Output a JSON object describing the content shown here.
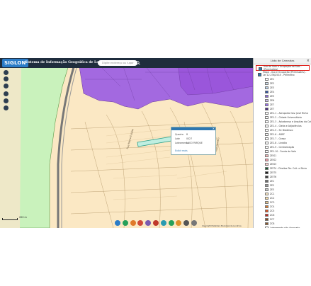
{
  "header": {
    "logo": "SIGLON",
    "title": "Sistema de Informação Geográfica de Londrina",
    "search_placeholder": "Digite endereço ou lugar"
  },
  "legend": {
    "title": "Lista de Camadas",
    "active_layer": "Uso do Solo e Ocupação do Solo - (Permissões)",
    "sub_layer": "Mapa - Uso e Ocupação (Permissões) - Lei 12.236/2015 - Perímetro",
    "items": [
      {
        "label": "ZE1",
        "color": "#ffffff"
      },
      {
        "label": "ZE2",
        "color": "#cfe0f0"
      },
      {
        "label": "ZE3",
        "color": "#b8d0e8"
      },
      {
        "label": "ZE4",
        "color": "#2c4fa0"
      },
      {
        "label": "ZE5",
        "color": "#8e6ad8"
      },
      {
        "label": "ZE6",
        "color": "#c9b8ea"
      },
      {
        "label": "ZE7",
        "color": "#9a6ef0"
      },
      {
        "label": "ZE7",
        "color": "#4b2a80"
      },
      {
        "label": "ZE1.1 - Aeroporto Gov. José Richa",
        "color": "#ffffff"
      },
      {
        "label": "ZE1.2 - Cidade Universitária",
        "color": "#ffffff"
      },
      {
        "label": "ZE1.3 - Aviadoroso e Arquitas do Café",
        "color": "#ffffff"
      },
      {
        "label": "ZE1.4 - Gleba e Adjacências",
        "color": "#ffffff"
      },
      {
        "label": "ZE1.5 - SC Bradesco",
        "color": "#ffffff"
      },
      {
        "label": "ZE1.6 - ADEF",
        "color": "#ffffff"
      },
      {
        "label": "ZE1.7 - Ceasa",
        "color": "#ffffff"
      },
      {
        "label": "ZE1.8 - Lindóia",
        "color": "#ffffff"
      },
      {
        "label": "ZE1.9 - Centralização",
        "color": "#ffffff"
      },
      {
        "label": "ZE1.10 - Fundo de Vale",
        "color": "#ffffff"
      },
      {
        "label": "ZEIS1",
        "color": "#f3b8b8"
      },
      {
        "label": "ZEIS2",
        "color": "#f59aa8"
      },
      {
        "label": "ZEIS3",
        "color": "#fbd0d0"
      },
      {
        "label": "ZEIT4 - Direitos Ter. Cult. e Sócio",
        "color": "#175a30"
      },
      {
        "label": "ZEIT5",
        "color": "#1a1a1a"
      },
      {
        "label": "ZEIT6",
        "color": "#3a3a3a"
      },
      {
        "label": "ZE1",
        "color": "#6b6b6b"
      },
      {
        "label": "ZE2",
        "color": "#9a9a9a"
      },
      {
        "label": "ZE3",
        "color": "#c8c8c8"
      },
      {
        "label": "ZC1",
        "color": "#fbe8c4"
      },
      {
        "label": "ZC2",
        "color": "#f2d9a8"
      },
      {
        "label": "ZC3",
        "color": "#e8c48a"
      },
      {
        "label": "ZC4",
        "color": "#e07a2a"
      },
      {
        "label": "ZC5",
        "color": "#d85020"
      },
      {
        "label": "ZC6",
        "color": "#c02820"
      },
      {
        "label": "ZC7",
        "color": "#8a4a20"
      },
      {
        "label": "ZC8",
        "color": "#8a5a30"
      },
      {
        "label": "Loteamento não Aprovado",
        "color": "#ffffff"
      }
    ]
  },
  "popup": {
    "row1_label": "Quadra",
    "row1_value": "8",
    "row2_label": "Lote",
    "row2_value": "0027",
    "row3_label": "Loteamento",
    "row3_value": "LAGO PARQUE",
    "link": "Exibir mais"
  },
  "map": {
    "road_label_1": "Rua Maria Eulália",
    "road_label_2": "Rua Ernesto",
    "scale": "200 m"
  },
  "footer": "Copyright Prefeitura Municipal de Londrina"
}
